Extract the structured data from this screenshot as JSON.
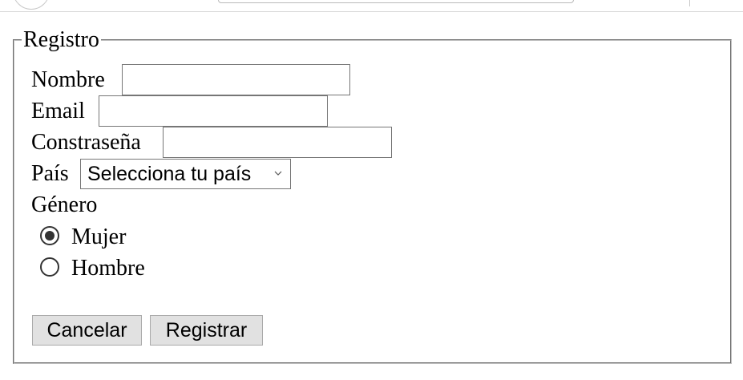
{
  "form": {
    "legend": "Registro",
    "fields": {
      "nombre": {
        "label": "Nombre",
        "value": ""
      },
      "email": {
        "label": "Email",
        "value": ""
      },
      "password": {
        "label": "Constraseña",
        "value": ""
      },
      "pais": {
        "label": "País",
        "selected": "Selecciona tu país"
      }
    },
    "gender": {
      "label": "Género",
      "options": [
        {
          "label": "Mujer",
          "checked": true
        },
        {
          "label": "Hombre",
          "checked": false
        }
      ]
    },
    "buttons": {
      "cancel": "Cancelar",
      "submit": "Registrar"
    }
  },
  "icons": {
    "select_arrow": "chevron-down-icon",
    "radio_selected": "radio-checked-icon",
    "radio_unselected": "radio-unchecked-icon"
  },
  "colors": {
    "border": "#767676",
    "button_bg": "#e1e1e1",
    "radio": "#333333"
  }
}
